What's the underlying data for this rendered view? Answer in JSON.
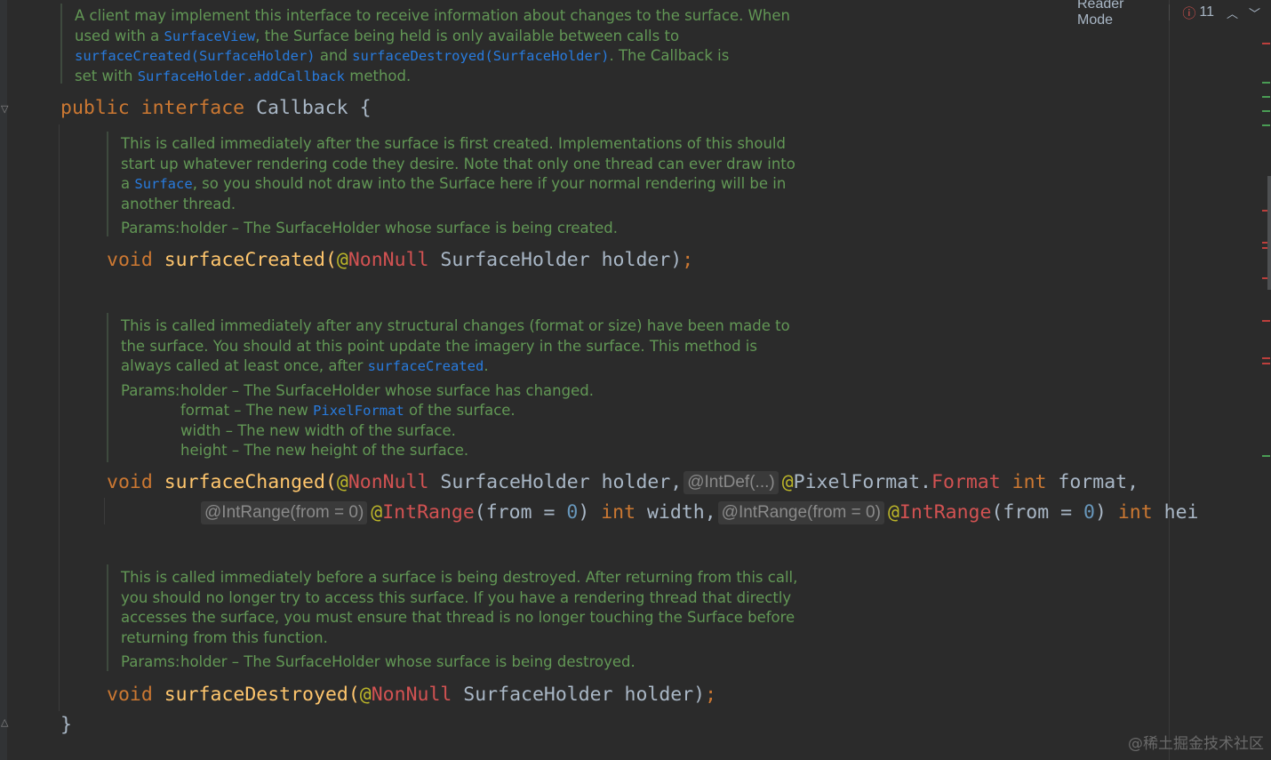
{
  "toolbar": {
    "reader_mode": "Reader Mode",
    "error_count": "11",
    "error_icon": "error-circle-icon",
    "up_icon": "chevron-up-icon",
    "down_icon": "chevron-down-icon"
  },
  "doc_interface": {
    "line1": "A client may implement this interface to receive information about changes to the surface. When",
    "line2_a": "used with a ",
    "line2_link": "SurfaceView",
    "line2_b": ", the Surface being held is only available between calls to",
    "line3_link1": "surfaceCreated(SurfaceHolder)",
    "line3_mid": " and ",
    "line3_link2": "surfaceDestroyed(SurfaceHolder)",
    "line3_b": ". The Callback is",
    "line4_a": "set with ",
    "line4_link": "SurfaceHolder.addCallback",
    "line4_b": " method."
  },
  "decl": {
    "public": "public",
    "interface": "interface",
    "name": " Callback {",
    "close": "}"
  },
  "doc_created": {
    "line1": "This is called immediately after the surface is first created. Implementations of this should",
    "line2": "start up whatever rendering code they desire. Note that only one thread can ever draw into",
    "line3_a": "a ",
    "line3_link": "Surface",
    "line3_b": ", so you should not draw into the Surface here if your normal rendering will be in",
    "line4": "another thread.",
    "params_label": "Params:",
    "param1": "holder – The SurfaceHolder whose surface is being created."
  },
  "sig_created": {
    "void": "void",
    "name": " surfaceCreated(",
    "ann": "@",
    "ann_name": "NonNull",
    "rest": " SurfaceHolder holder)",
    "semi": ";"
  },
  "doc_changed": {
    "line1": "This is called immediately after any structural changes (format or size) have been made to",
    "line2": "the surface. You should at this point update the imagery in the surface. This method is",
    "line3_a": "always called at least once, after ",
    "line3_link": "surfaceCreated",
    "line3_b": ".",
    "params_label": "Params:",
    "param1": "holder – The SurfaceHolder whose surface has changed.",
    "param2_a": "format – The new ",
    "param2_link": "PixelFormat",
    "param2_b": " of the surface.",
    "param3": "width – The new width of the surface.",
    "param4": "height – The new height of the surface."
  },
  "sig_changed": {
    "void": "void",
    "name": " surfaceChanged(",
    "ann": "@",
    "ann_name": "NonNull",
    "rest1": " SurfaceHolder holder,",
    "hint1": "@IntDef(...)",
    "ann2": "@",
    "ann2_rest": "PixelFormat.",
    "ann2_name": "Format",
    "int1": " int",
    "format": " format,",
    "hint2": "@IntRange(from = 0)",
    "ann3": "@",
    "ann3_name": "IntRange",
    "from1a": "(from = ",
    "zero1": "0",
    "from1b": ")",
    "int2": " int",
    "width": " width,",
    "hint3": "@IntRange(from = 0)",
    "ann4": "@",
    "ann4_name": "IntRange",
    "from2a": "(from = ",
    "zero2": "0",
    "from2b": ")",
    "int3": " int",
    "hei": " hei"
  },
  "doc_destroyed": {
    "line1": "This is called immediately before a surface is being destroyed. After returning from this call,",
    "line2": "you should no longer try to access this surface. If you have a rendering thread that directly",
    "line3": "accesses the surface, you must ensure that thread is no longer touching the Surface before",
    "line4": "returning from this function.",
    "params_label": "Params:",
    "param1": "holder – The SurfaceHolder whose surface is being destroyed."
  },
  "sig_destroyed": {
    "void": "void",
    "name": " surfaceDestroyed(",
    "ann": "@",
    "ann_name": "NonNull",
    "rest": " SurfaceHolder holder)",
    "semi": ";"
  },
  "watermark": "@稀土掘金技术社区",
  "colors": {
    "background": "#2b2b2b",
    "doc_text": "#629755",
    "keyword": "#cc7832",
    "method": "#ffc66d",
    "annotation": "#bbb529",
    "link": "#287bde",
    "error": "#d9534f"
  }
}
